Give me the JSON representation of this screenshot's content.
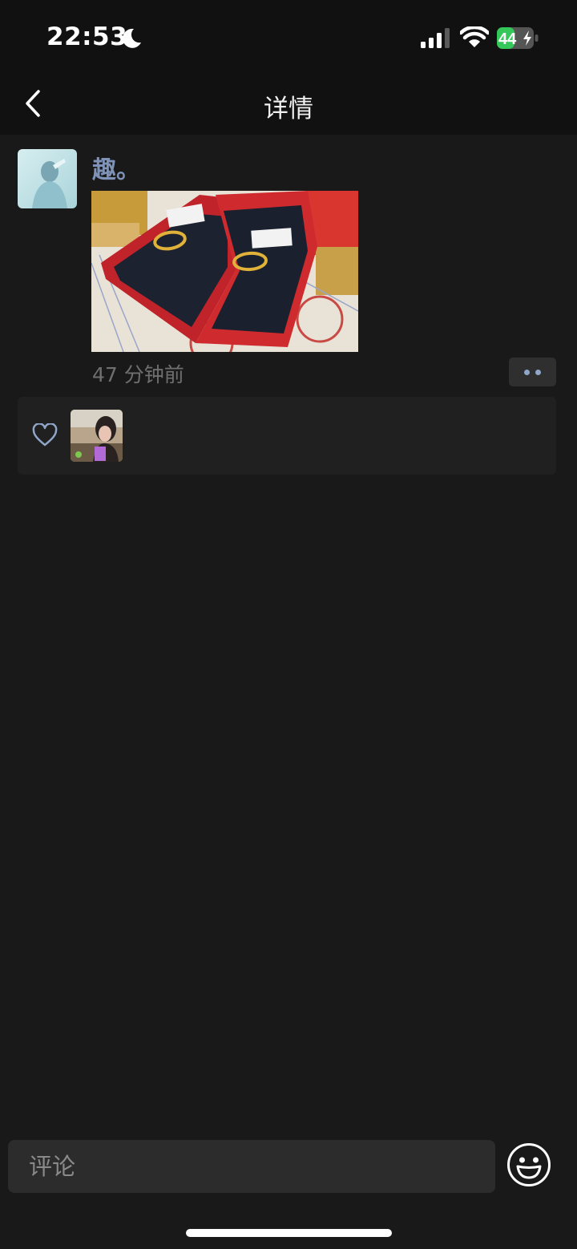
{
  "status_bar": {
    "time": "22:53",
    "battery_level": "44",
    "icons": [
      "moon-icon",
      "signal-icon",
      "wifi-icon",
      "battery-icon"
    ]
  },
  "nav": {
    "title": "详情",
    "back_icon": "chevron-left-icon"
  },
  "post": {
    "author": "趣。",
    "time_ago": "47 分钟前",
    "photo_subject": "gold rings in red boxes",
    "more_icon": "more-dots-icon"
  },
  "likes": {
    "icon": "heart-icon",
    "count": 1
  },
  "comment": {
    "placeholder": "评论",
    "emoji_icon": "emoji-icon"
  },
  "colors": {
    "background": "#191919",
    "bar": "#111111",
    "author_name": "#7f93b8",
    "battery": "#34c759",
    "panel": "#202020"
  }
}
